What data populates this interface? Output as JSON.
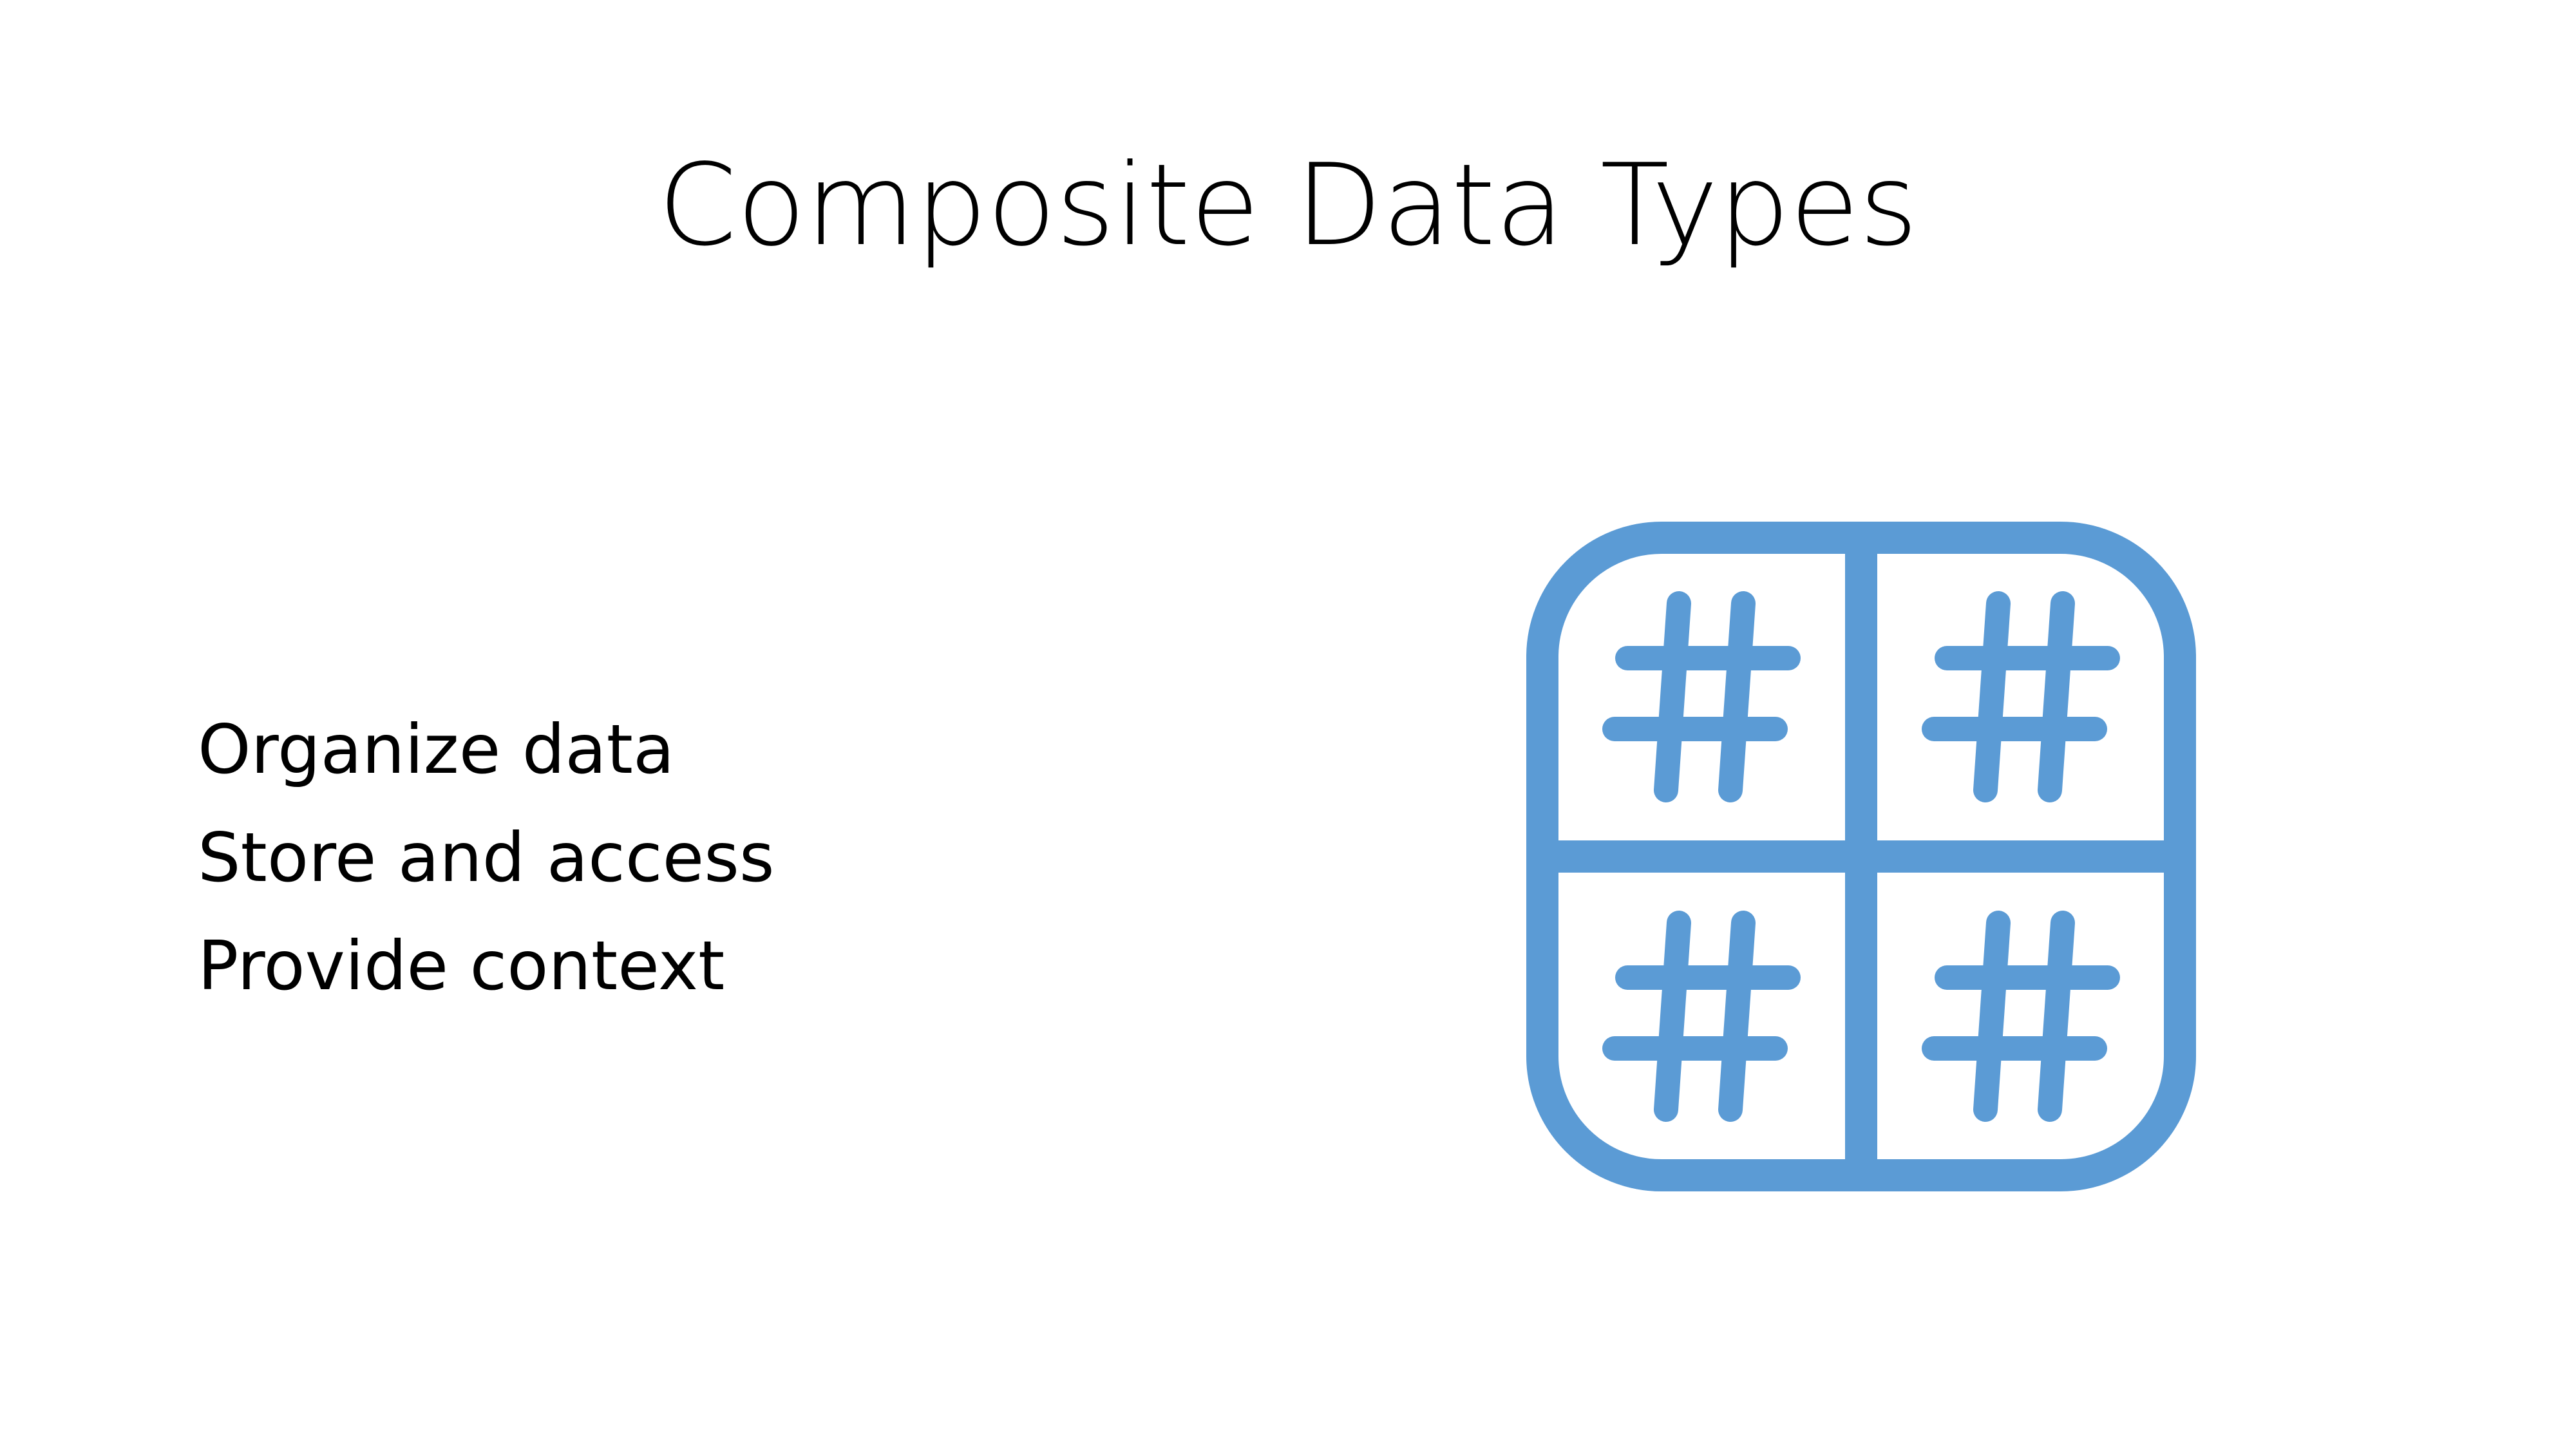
{
  "slide": {
    "title": "Composite Data Types",
    "bullets": [
      "Organize data",
      "Store and access",
      "Provide context"
    ]
  },
  "icon": {
    "name": "grid-hash-icon",
    "color": "#5B9BD5"
  },
  "colors": {
    "background": "#FFFFFF",
    "text": "#000000",
    "accent": "#5B9BD5"
  }
}
